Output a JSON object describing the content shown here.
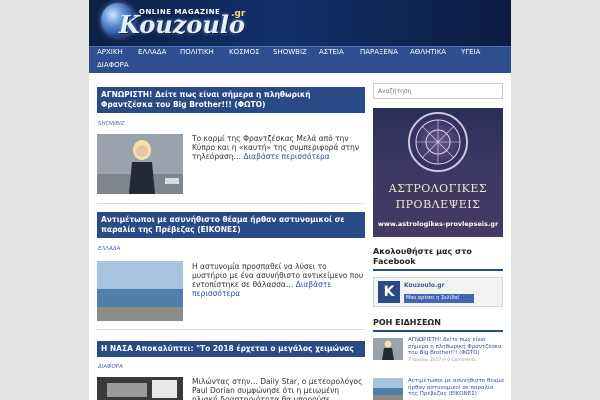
{
  "header": {
    "logo_tag": "ONLINE MAGAZINE",
    "logo_main": "Kouzoulo",
    "logo_suffix": ".gr"
  },
  "nav": {
    "items": [
      "ΑΡΧΙΚΗ",
      "ΕΛΛΑΔΑ",
      "ΠΟΛΙΤΙΚΗ",
      "ΚΟΣΜΟΣ",
      "SHOWBIZ",
      "ΑΣΤΕΙΑ",
      "ΠΑΡΑΞΕΝΑ",
      "ΑΘΛΗΤΙΚΑ",
      "ΥΓΕΙΑ",
      "ΔΙΑΦΟΡΑ"
    ]
  },
  "posts": [
    {
      "title": "ΑΓΝΩΡΙΣΤΗ! Δείτε πως είναι σήμερα η πληθωρική Φραντζέσκα του Big Brother!!! (ΦΩΤΟ)",
      "category": "SHOWBIZ",
      "excerpt": "Το κορμί της Φραντζέσκας Μελά από την Κύπρο και η «καυτή» της συμπεριφορά στην τηλεόραση…",
      "read_more": "Διαβάστε περισσότερα"
    },
    {
      "title": "Αντιμέτωποι με ασυνήθιστο θέαμα ήρθαν αστυνομικοί σε παραλία της Πρέβεζας (ΕΙΚΟΝΕΣ)",
      "category": "ΕΛΛΑΔΑ",
      "excerpt": "Η αστυνομία προσπαθεί να λύσει το μυστήριο με ένα ασυνήθιστο αντικείμενο που εντοπίστηκε σε θάλασσα…",
      "read_more": "Διαβάστε περισσότερα"
    },
    {
      "title": "Η ΝΑΣΑ Αποκαλύπτει: \"Το 2018 έρχεται ο μεγάλος χειμώνας",
      "category": "ΔΙΑΦΟΡΑ",
      "excerpt": "Μιλώντας στην… Daily Star, ο μετεορολόγος Paul Dorian συμφώνησε ότι η μειωμένη ηλιακή δραστηριότητα θα μπορούσε…",
      "read_more": ""
    }
  ],
  "sidebar": {
    "search_placeholder": "Αναζήτηση",
    "astro_title_line1": "ΑΣΤΡΟΛΟΓΙΚΕΣ",
    "astro_title_line2": "ΠΡΟΒΛΕΨΕΙΣ",
    "astro_url": "www.astrologikes-provlepseis.gr",
    "follow_title": "Ακολουθήστε μας στο Facebook",
    "fb_page_name": "Kouzoulo.gr",
    "fb_like_label": "Μου αρέσει η Σελίδα!",
    "news_title": "ΡΟΗ ΕΙΔΗΣΕΩΝ",
    "news": [
      {
        "title": "ΑΓΝΩΡΙΣΤΗ! Δείτε πως είναι σήμερα η πληθωρική Φραντζέσκα του Big Brother!!! (ΦΩΤΟ)",
        "meta": "7 Ιουνίου 2017 // 0 Comments"
      },
      {
        "title": "Αντιμέτωποι με ασυνήθιστο θέαμα ήρθαν αστυνομικοί σε παραλία της Πρέβεζας (ΕΙΚΟΝΕΣ)",
        "meta": ""
      }
    ]
  },
  "colors": {
    "header_bg": "#13306b",
    "nav_bg": "#2f4f91",
    "title_bar": "#2a4a86",
    "link": "#3050a0"
  }
}
